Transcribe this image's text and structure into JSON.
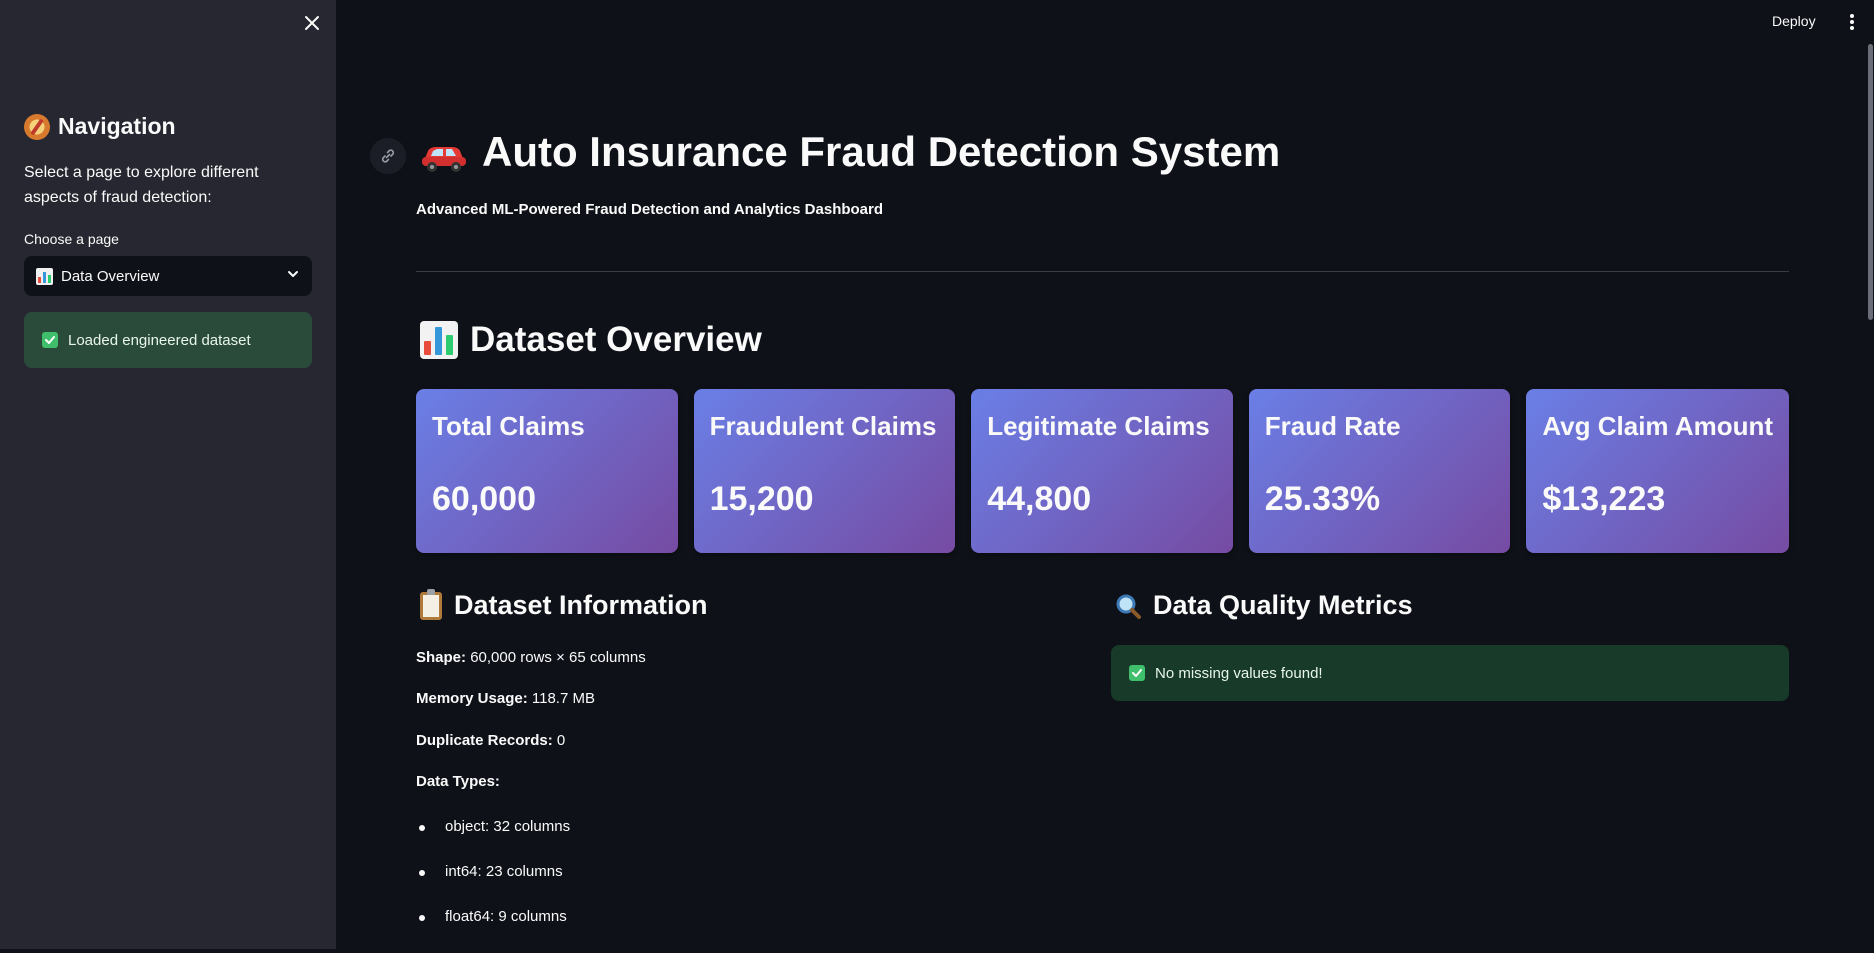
{
  "sidebar": {
    "nav_title": "Navigation",
    "nav_description": "Select a page to explore different aspects of fraud detection:",
    "choose_label": "Choose a page",
    "selected_page": "Data Overview",
    "status_message": "Loaded engineered dataset"
  },
  "topbar": {
    "deploy_label": "Deploy"
  },
  "header": {
    "title": "Auto Insurance Fraud Detection System",
    "subtitle": "Advanced ML-Powered Fraud Detection and Analytics Dashboard"
  },
  "overview": {
    "heading": "Dataset Overview",
    "metrics": [
      {
        "label": "Total Claims",
        "value": "60,000"
      },
      {
        "label": "Fraudulent Claims",
        "value": "15,200"
      },
      {
        "label": "Legitimate Claims",
        "value": "44,800"
      },
      {
        "label": "Fraud Rate",
        "value": "25.33%"
      },
      {
        "label": "Avg Claim Amount",
        "value": "$13,223"
      }
    ]
  },
  "dataset_info": {
    "heading": "Dataset Information",
    "shape_label": "Shape:",
    "shape_value": "60,000 rows × 65 columns",
    "memory_label": "Memory Usage:",
    "memory_value": "118.7 MB",
    "duplicates_label": "Duplicate Records:",
    "duplicates_value": "0",
    "types_label": "Data Types:",
    "types": [
      "object: 32 columns",
      "int64: 23 columns",
      "float64: 9 columns"
    ]
  },
  "quality": {
    "heading": "Data Quality Metrics",
    "message": "No missing values found!"
  },
  "colors": {
    "background": "#0e1117",
    "sidebar": "#262730",
    "card_gradient_start": "#6a7fe6",
    "card_gradient_end": "#764ba2",
    "success": "#2b4b3a"
  }
}
